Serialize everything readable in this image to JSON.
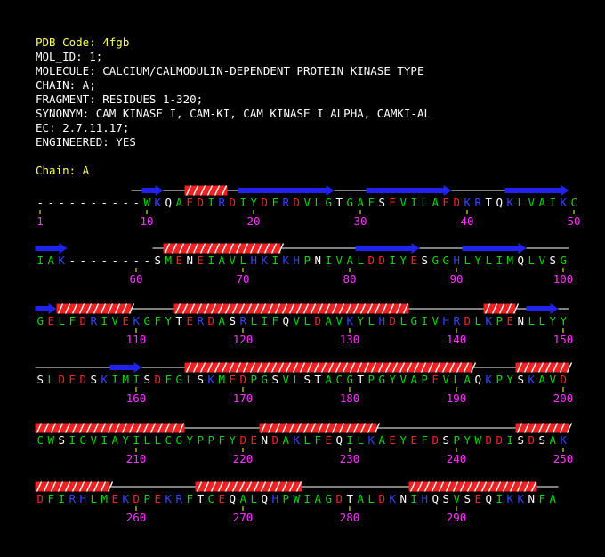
{
  "header": {
    "pdb_code": "PDB Code: 4fgb",
    "mol_id": "MOL_ID: 1;",
    "molecule": "MOLECULE: CALCIUM/CALMODULIN-DEPENDENT PROTEIN KINASE TYPE",
    "chain_line": "CHAIN: A;",
    "fragment": "FRAGMENT: RESIDUES 1-320;",
    "synonym": "SYNONYM: CAM KINASE I, CAM-KI, CAM KINASE I ALPHA, CAMKI-AL",
    "ec": "EC: 2.7.11.17;",
    "engineered": "ENGINEERED: YES",
    "chain_label": "Chain: A"
  },
  "colors": {
    "background": "#000000",
    "header_text": "#ffffff",
    "highlight_text": "#ffff66",
    "residue_hydrophobic": "#00dd00",
    "residue_polar": "#ffffff",
    "residue_acidic": "#ff2222",
    "residue_basic": "#3344ff",
    "gap": "#ffffff",
    "number": "#ff33ff",
    "helix": "#ee2222",
    "strand": "#2222ee",
    "coil": "#ffffff"
  },
  "sequence_rows": [
    {
      "seq": "----------WKQAEDIRDIYDFRDVLGTGAFSEVILAEDKRTQKLVAIKC",
      "numbers": [
        {
          "col": 0,
          "label": "1"
        },
        {
          "col": 10,
          "label": "10"
        },
        {
          "col": 20,
          "label": "20"
        },
        {
          "col": 30,
          "label": "30"
        },
        {
          "col": 40,
          "label": "40"
        },
        {
          "col": 50,
          "label": "50"
        }
      ],
      "ss": [
        {
          "type": "coil",
          "start": 9,
          "end": 11
        },
        {
          "type": "strand",
          "start": 10,
          "end": 12
        },
        {
          "type": "coil",
          "start": 12,
          "end": 14
        },
        {
          "type": "helix",
          "start": 14,
          "end": 18
        },
        {
          "type": "coil",
          "start": 18,
          "end": 19
        },
        {
          "type": "strand",
          "start": 19,
          "end": 28
        },
        {
          "type": "coil",
          "start": 28,
          "end": 31
        },
        {
          "type": "strand",
          "start": 31,
          "end": 39
        },
        {
          "type": "coil",
          "start": 39,
          "end": 44
        },
        {
          "type": "strand",
          "start": 44,
          "end": 50
        }
      ]
    },
    {
      "seq": "IAK--------SMENEIAVLHKIKHPNIVALDDIYESGGHLYLIMQLVSG",
      "numbers": [
        {
          "col": 9,
          "label": "60"
        },
        {
          "col": 19,
          "label": "70"
        },
        {
          "col": 29,
          "label": "80"
        },
        {
          "col": 39,
          "label": "90"
        },
        {
          "col": 49,
          "label": "100"
        }
      ],
      "ss": [
        {
          "type": "strand",
          "start": 0,
          "end": 3
        },
        {
          "type": "coil",
          "start": 11,
          "end": 12
        },
        {
          "type": "helix",
          "start": 12,
          "end": 23
        },
        {
          "type": "coil",
          "start": 23,
          "end": 30
        },
        {
          "type": "strand",
          "start": 30,
          "end": 36
        },
        {
          "type": "coil",
          "start": 36,
          "end": 40
        },
        {
          "type": "strand",
          "start": 40,
          "end": 46
        },
        {
          "type": "coil",
          "start": 46,
          "end": 50
        }
      ]
    },
    {
      "seq": "GELFDRIVEKGFYTERDASRLIFQVLDAVKYLHDLGIVHRDLKPENLLYY",
      "numbers": [
        {
          "col": 9,
          "label": "110"
        },
        {
          "col": 19,
          "label": "120"
        },
        {
          "col": 29,
          "label": "130"
        },
        {
          "col": 39,
          "label": "140"
        },
        {
          "col": 49,
          "label": "150"
        }
      ],
      "ss": [
        {
          "type": "strand",
          "start": 0,
          "end": 2
        },
        {
          "type": "helix",
          "start": 2,
          "end": 9
        },
        {
          "type": "coil",
          "start": 9,
          "end": 13
        },
        {
          "type": "helix",
          "start": 13,
          "end": 35
        },
        {
          "type": "coil",
          "start": 35,
          "end": 42
        },
        {
          "type": "helix",
          "start": 42,
          "end": 45
        },
        {
          "type": "coil",
          "start": 45,
          "end": 46
        },
        {
          "type": "strand",
          "start": 46,
          "end": 49
        },
        {
          "type": "coil",
          "start": 49,
          "end": 50
        }
      ]
    },
    {
      "seq": "SLDEDSKIMISDFGLSKMEDPGSVLSTACGTPGYVAPEVLAQKPYSKAVD",
      "numbers": [
        {
          "col": 9,
          "label": "160"
        },
        {
          "col": 19,
          "label": "170"
        },
        {
          "col": 29,
          "label": "180"
        },
        {
          "col": 39,
          "label": "190"
        },
        {
          "col": 49,
          "label": "200"
        }
      ],
      "ss": [
        {
          "type": "coil",
          "start": 0,
          "end": 7
        },
        {
          "type": "strand",
          "start": 7,
          "end": 10
        },
        {
          "type": "coil",
          "start": 10,
          "end": 14
        },
        {
          "type": "helix",
          "start": 14,
          "end": 41
        },
        {
          "type": "coil",
          "start": 41,
          "end": 45
        },
        {
          "type": "helix",
          "start": 45,
          "end": 50
        }
      ]
    },
    {
      "seq": "CWSIGVIAYILLCGYPPFYDENDAKLFEQILKAEYEFDSPYWDDISDSAK",
      "numbers": [
        {
          "col": 9,
          "label": "210"
        },
        {
          "col": 19,
          "label": "220"
        },
        {
          "col": 29,
          "label": "230"
        },
        {
          "col": 39,
          "label": "240"
        },
        {
          "col": 49,
          "label": "250"
        }
      ],
      "ss": [
        {
          "type": "helix",
          "start": 0,
          "end": 14
        },
        {
          "type": "coil",
          "start": 14,
          "end": 21
        },
        {
          "type": "helix",
          "start": 21,
          "end": 32
        },
        {
          "type": "coil",
          "start": 32,
          "end": 45
        },
        {
          "type": "helix",
          "start": 45,
          "end": 50
        }
      ]
    },
    {
      "seq": "DFIRHLMEKDPEKRFTCEQALQHPWIAGDTALDKNIHQSVSEQIKKNFA",
      "numbers": [
        {
          "col": 9,
          "label": "260"
        },
        {
          "col": 19,
          "label": "270"
        },
        {
          "col": 29,
          "label": "280"
        },
        {
          "col": 39,
          "label": "290"
        }
      ],
      "ss": [
        {
          "type": "helix",
          "start": 0,
          "end": 7
        },
        {
          "type": "coil",
          "start": 7,
          "end": 15
        },
        {
          "type": "helix",
          "start": 15,
          "end": 25
        },
        {
          "type": "coil",
          "start": 25,
          "end": 35
        },
        {
          "type": "helix",
          "start": 35,
          "end": 47
        },
        {
          "type": "coil",
          "start": 47,
          "end": 49
        }
      ]
    }
  ]
}
